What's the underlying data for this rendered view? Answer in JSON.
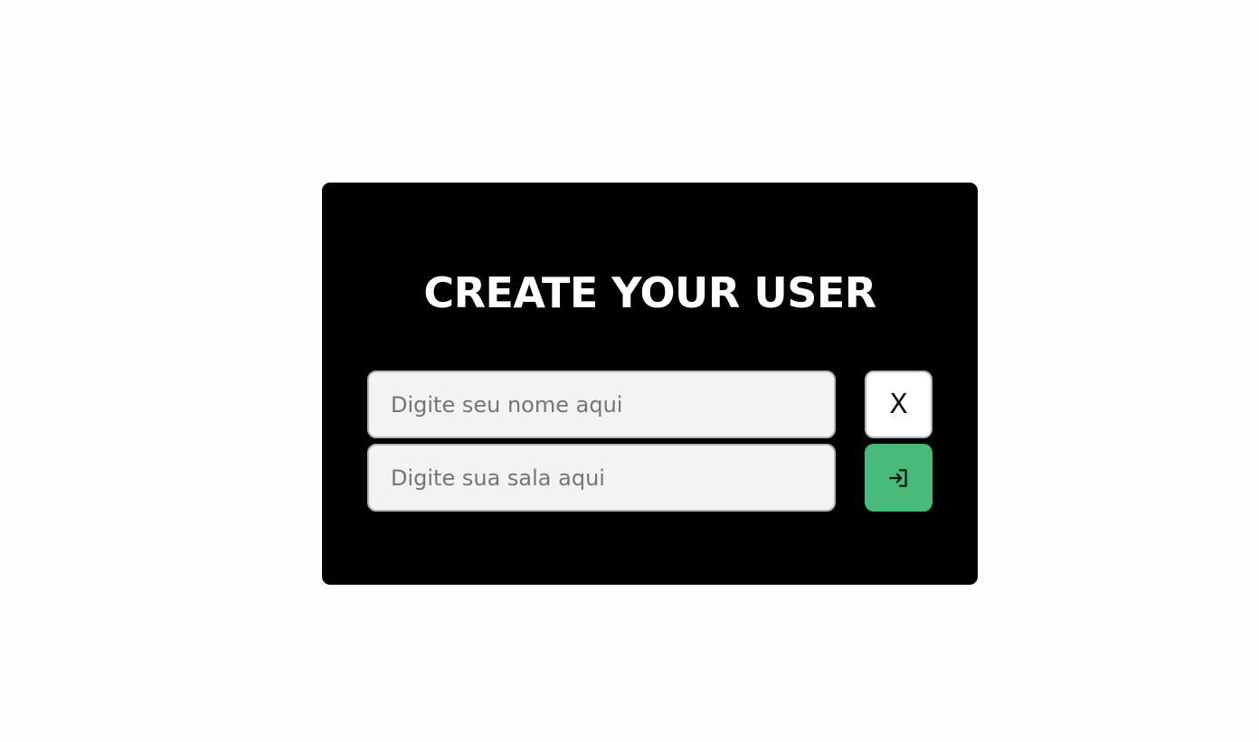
{
  "modal": {
    "title": "CREATE YOUR USER",
    "name_input": {
      "value": "",
      "placeholder": "Digite seu nome aqui"
    },
    "room_input": {
      "value": "",
      "placeholder": "Digite sua sala aqui"
    },
    "close_button": {
      "label": "X"
    },
    "enter_button": {
      "icon": "login-icon",
      "color": "#48bb78"
    }
  }
}
